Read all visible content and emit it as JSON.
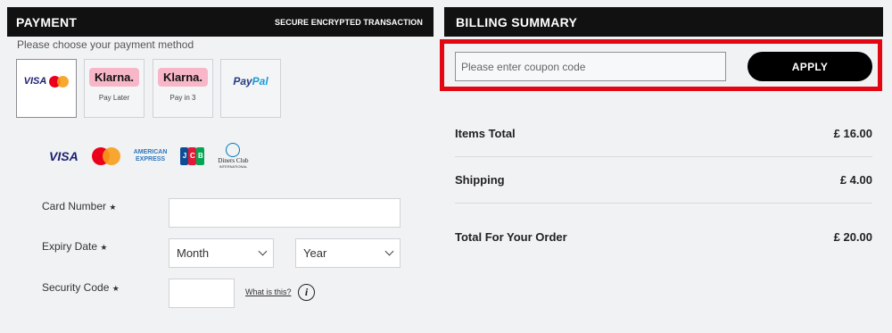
{
  "payment": {
    "title": "PAYMENT",
    "secure_label": "SECURE ENCRYPTED TRANSACTION",
    "instruction": "Please choose your payment method",
    "methods": [
      {
        "id": "visa-mastercard",
        "logo_text": "VISA",
        "sub": ""
      },
      {
        "id": "klarna-pay-later",
        "logo_text": "Klarna.",
        "sub": "Pay Later"
      },
      {
        "id": "klarna-pay-in-3",
        "logo_text": "Klarna.",
        "sub": "Pay in 3"
      },
      {
        "id": "paypal",
        "logo_text_1": "Pay",
        "logo_text_2": "Pal",
        "sub": ""
      }
    ],
    "brands": {
      "visa": "VISA",
      "amex_line1": "AMERICAN",
      "amex_line2": "EXPRESS",
      "jcb": [
        "J",
        "C",
        "B"
      ],
      "diners_line1": "Diners Club",
      "diners_line2": "INTERNATIONAL"
    },
    "fields": {
      "card_number_label": "Card Number",
      "expiry_label": "Expiry Date",
      "security_label": "Security Code",
      "required_mark": "★",
      "month_value": "Month",
      "year_value": "Year",
      "what_is_this": "What is this?",
      "info_glyph": "i"
    }
  },
  "billing": {
    "title": "BILLING SUMMARY",
    "coupon_placeholder": "Please enter coupon code",
    "apply_label": "APPLY",
    "items_total_label": "Items Total",
    "items_total_value": "£ 16.00",
    "shipping_label": "Shipping",
    "shipping_value": "£ 4.00",
    "total_label": "Total For Your Order",
    "total_value": "£ 20.00"
  },
  "colors": {
    "highlight": "#e30613",
    "header_bg": "#111111",
    "klarna_pink": "#f7b7c8"
  },
  "icons": [
    "mastercard-icon",
    "info-icon",
    "chevron-down-icon"
  ]
}
